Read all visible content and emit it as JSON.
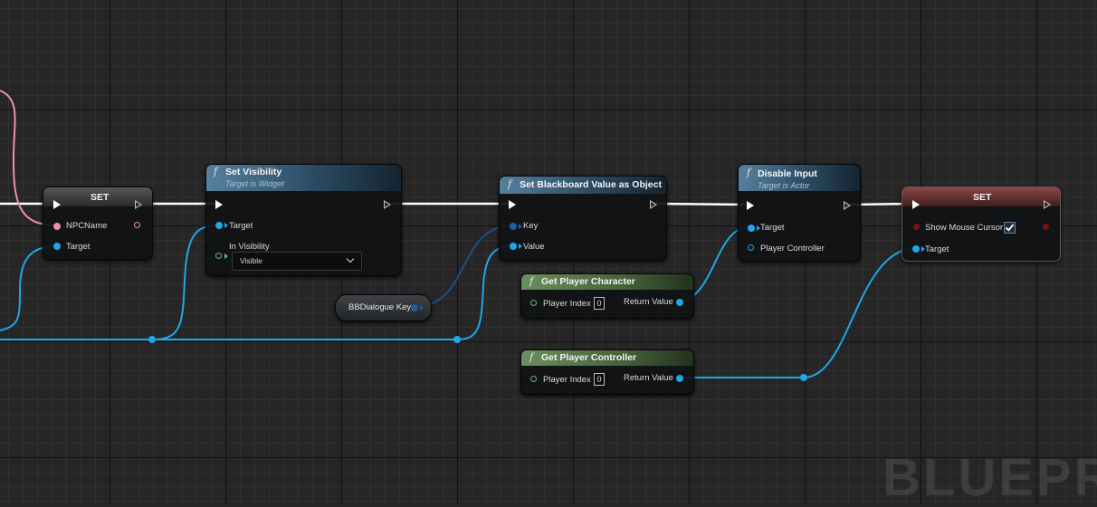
{
  "watermark": "BLUEPRIN",
  "nodes": {
    "set_npc": {
      "title": "SET",
      "pins": {
        "npc_name": "NPCName",
        "target": "Target"
      }
    },
    "set_visibility": {
      "icon": "f",
      "title": "Set Visibility",
      "subtitle": "Target is Widget",
      "pins": {
        "target": "Target",
        "in_visibility": "In Visibility"
      },
      "in_visibility_value": "Visible"
    },
    "bb_key": {
      "label": "BBDialogue Key"
    },
    "set_bb_value": {
      "icon": "f",
      "title": "Set Blackboard Value as Object",
      "pins": {
        "key": "Key",
        "value": "Value"
      }
    },
    "get_player_character": {
      "icon": "f",
      "title": "Get Player Character",
      "pins": {
        "player_index": "Player Index",
        "return_value": "Return Value"
      },
      "player_index_value": "0"
    },
    "get_player_controller": {
      "icon": "f",
      "title": "Get Player Controller",
      "pins": {
        "player_index": "Player Index",
        "return_value": "Return Value"
      },
      "player_index_value": "0"
    },
    "disable_input": {
      "icon": "f",
      "title": "Disable Input",
      "subtitle": "Target is Actor",
      "pins": {
        "target": "Target",
        "player_controller": "Player Controller"
      }
    },
    "set_mouse": {
      "title": "SET",
      "pins": {
        "show_mouse_cursor": "Show Mouse Cursor",
        "target": "Target"
      },
      "show_mouse_cursor_checked": true
    }
  },
  "colors": {
    "exec_wire": "#ffffff",
    "object_wire": "#1fa7e8",
    "string_wire": "#ef8fa4",
    "key_wire": "#1d4f84",
    "function_header": "#55819e",
    "pure_header": "#6b8f5e",
    "set_header_red": "#8e4646"
  }
}
